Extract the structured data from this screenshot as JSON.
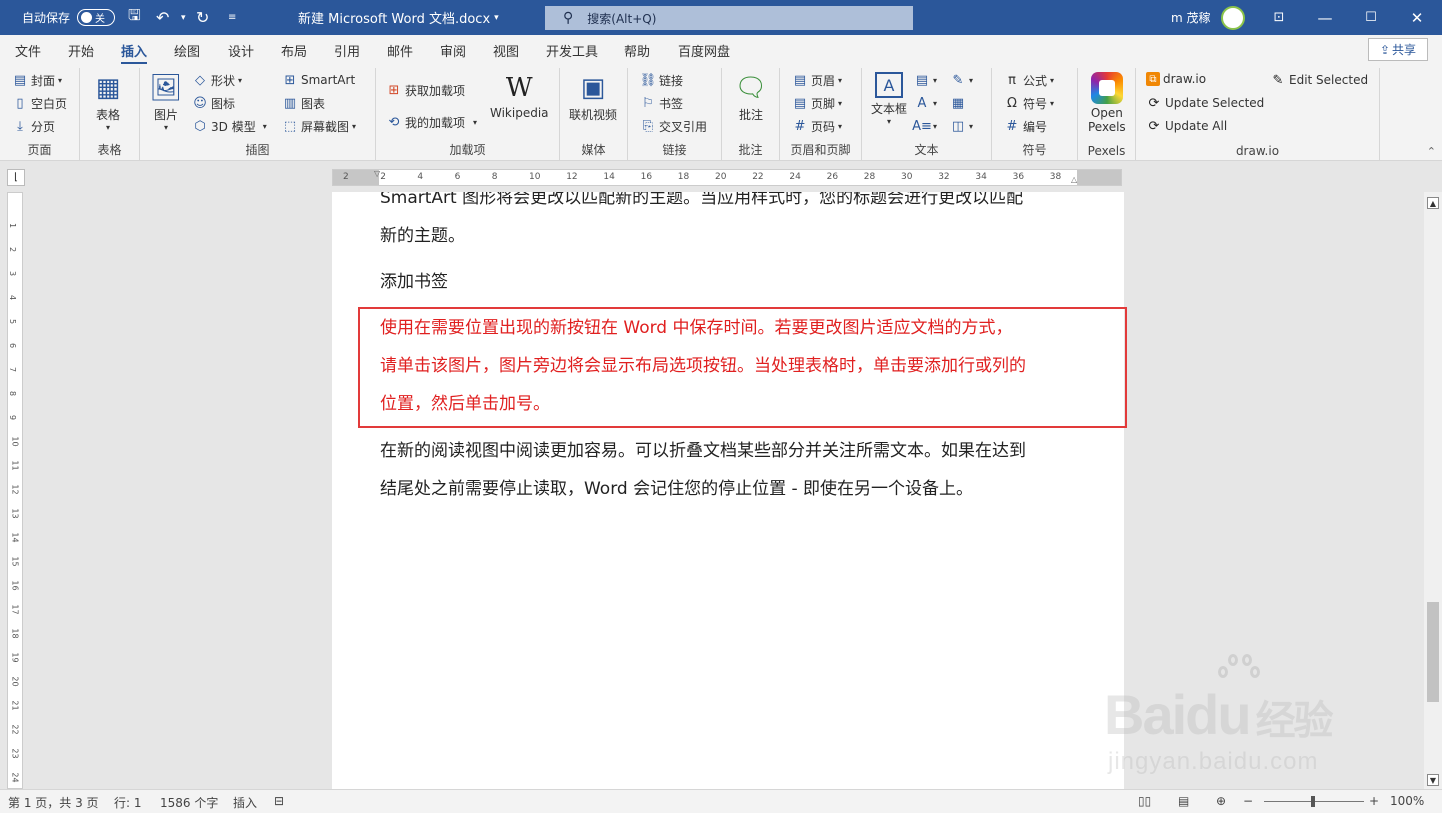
{
  "titlebar": {
    "autosave_label": "自动保存",
    "autosave_state": "关",
    "doc_title": "新建 Microsoft Word 文档.docx",
    "search_placeholder": "搜索(Alt+Q)",
    "user_name": "m 茂稼"
  },
  "tabs": [
    "文件",
    "开始",
    "插入",
    "绘图",
    "设计",
    "布局",
    "引用",
    "邮件",
    "审阅",
    "视图",
    "开发工具",
    "帮助",
    "百度网盘"
  ],
  "active_tab": "插入",
  "share_label": "共享",
  "ribbon": {
    "pages": {
      "cover": "封面",
      "blank": "空白页",
      "break": "分页",
      "label": "页面"
    },
    "tables": {
      "table": "表格",
      "label": "表格"
    },
    "illustrations": {
      "picture": "图片",
      "shapes": "形状",
      "icons": "图标",
      "model3d": "3D 模型",
      "smartart": "SmartArt",
      "chart": "图表",
      "screenshot": "屏幕截图",
      "label": "插图"
    },
    "addins": {
      "get": "获取加载项",
      "mine": "我的加载项",
      "wikipedia": "Wikipedia",
      "label": "加载项"
    },
    "media": {
      "video": "联机视频",
      "label": "媒体"
    },
    "links": {
      "link": "链接",
      "bookmark": "书签",
      "crossref": "交叉引用",
      "label": "链接"
    },
    "comments": {
      "comment": "批注",
      "label": "批注"
    },
    "headerfooter": {
      "header": "页眉",
      "footer": "页脚",
      "pagenum": "页码",
      "label": "页眉和页脚"
    },
    "text": {
      "textbox": "文本框",
      "label": "文本"
    },
    "symbols": {
      "equation": "公式",
      "symbol": "符号",
      "number": "编号",
      "label": "符号"
    },
    "pexels": {
      "open1": "Open",
      "open2": "Pexels",
      "label": "Pexels"
    },
    "drawio": {
      "drawio": "draw.io",
      "update_selected": "Update Selected",
      "update_all": "Update All",
      "edit_selected": "Edit Selected",
      "label": "draw.io"
    }
  },
  "ruler_ticks": [
    "2",
    "2",
    "4",
    "6",
    "8",
    "10",
    "12",
    "14",
    "16",
    "18",
    "20",
    "22",
    "24",
    "26",
    "28",
    "30",
    "32",
    "34",
    "36",
    "38"
  ],
  "document": {
    "para1_line1": "SmartArt 图形将会更改以匹配新的主题。当应用样式时，您的标题会进行更改以匹配",
    "para1_line2": "新的主题。",
    "heading": "添加书签",
    "red_line1": "使用在需要位置出现的新按钮在 Word 中保存时间。若要更改图片适应文档的方式，",
    "red_line2": "请单击该图片，图片旁边将会显示布局选项按钮。当处理表格时，单击要添加行或列的",
    "red_line3": "位置，然后单击加号。",
    "para3_line1": "在新的阅读视图中阅读更加容易。可以折叠文档某些部分并关注所需文本。如果在达到",
    "para3_line2": "结尾处之前需要停止读取，Word 会记住您的停止位置 - 即使在另一个设备上。"
  },
  "status": {
    "page": "第 1 页，共 3 页",
    "line": "行: 1",
    "words": "1586 个字",
    "mode": "插入",
    "zoom": "100%"
  },
  "watermark": {
    "brand": "Baidu",
    "cn": "经验",
    "url": "jingyan.baidu.com"
  },
  "colors": {
    "accent": "#2b579a",
    "highlight_border": "#e23a3a",
    "highlight_text": "#e02020"
  }
}
